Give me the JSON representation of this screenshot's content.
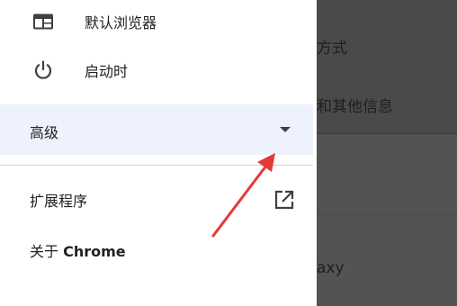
{
  "background": {
    "frag1": "方式",
    "frag2": "和其他信息",
    "frag3": "axy"
  },
  "menu": {
    "default_browser": {
      "label": "默认浏览器",
      "icon": "browser-window-icon"
    },
    "on_startup": {
      "label": "启动时",
      "icon": "power-icon"
    },
    "advanced": {
      "label": "高级",
      "icon": "caret-down-icon"
    },
    "extensions": {
      "label": "扩展程序",
      "icon": "open-in-new-icon"
    },
    "about": {
      "prefix": "关于 ",
      "brand": "Chrome"
    }
  },
  "colors": {
    "selected_bg": "#eef2fc",
    "text": "#202124",
    "icon": "#3c4043",
    "backdrop": "#535353",
    "annotation_arrow": "#e53935"
  }
}
